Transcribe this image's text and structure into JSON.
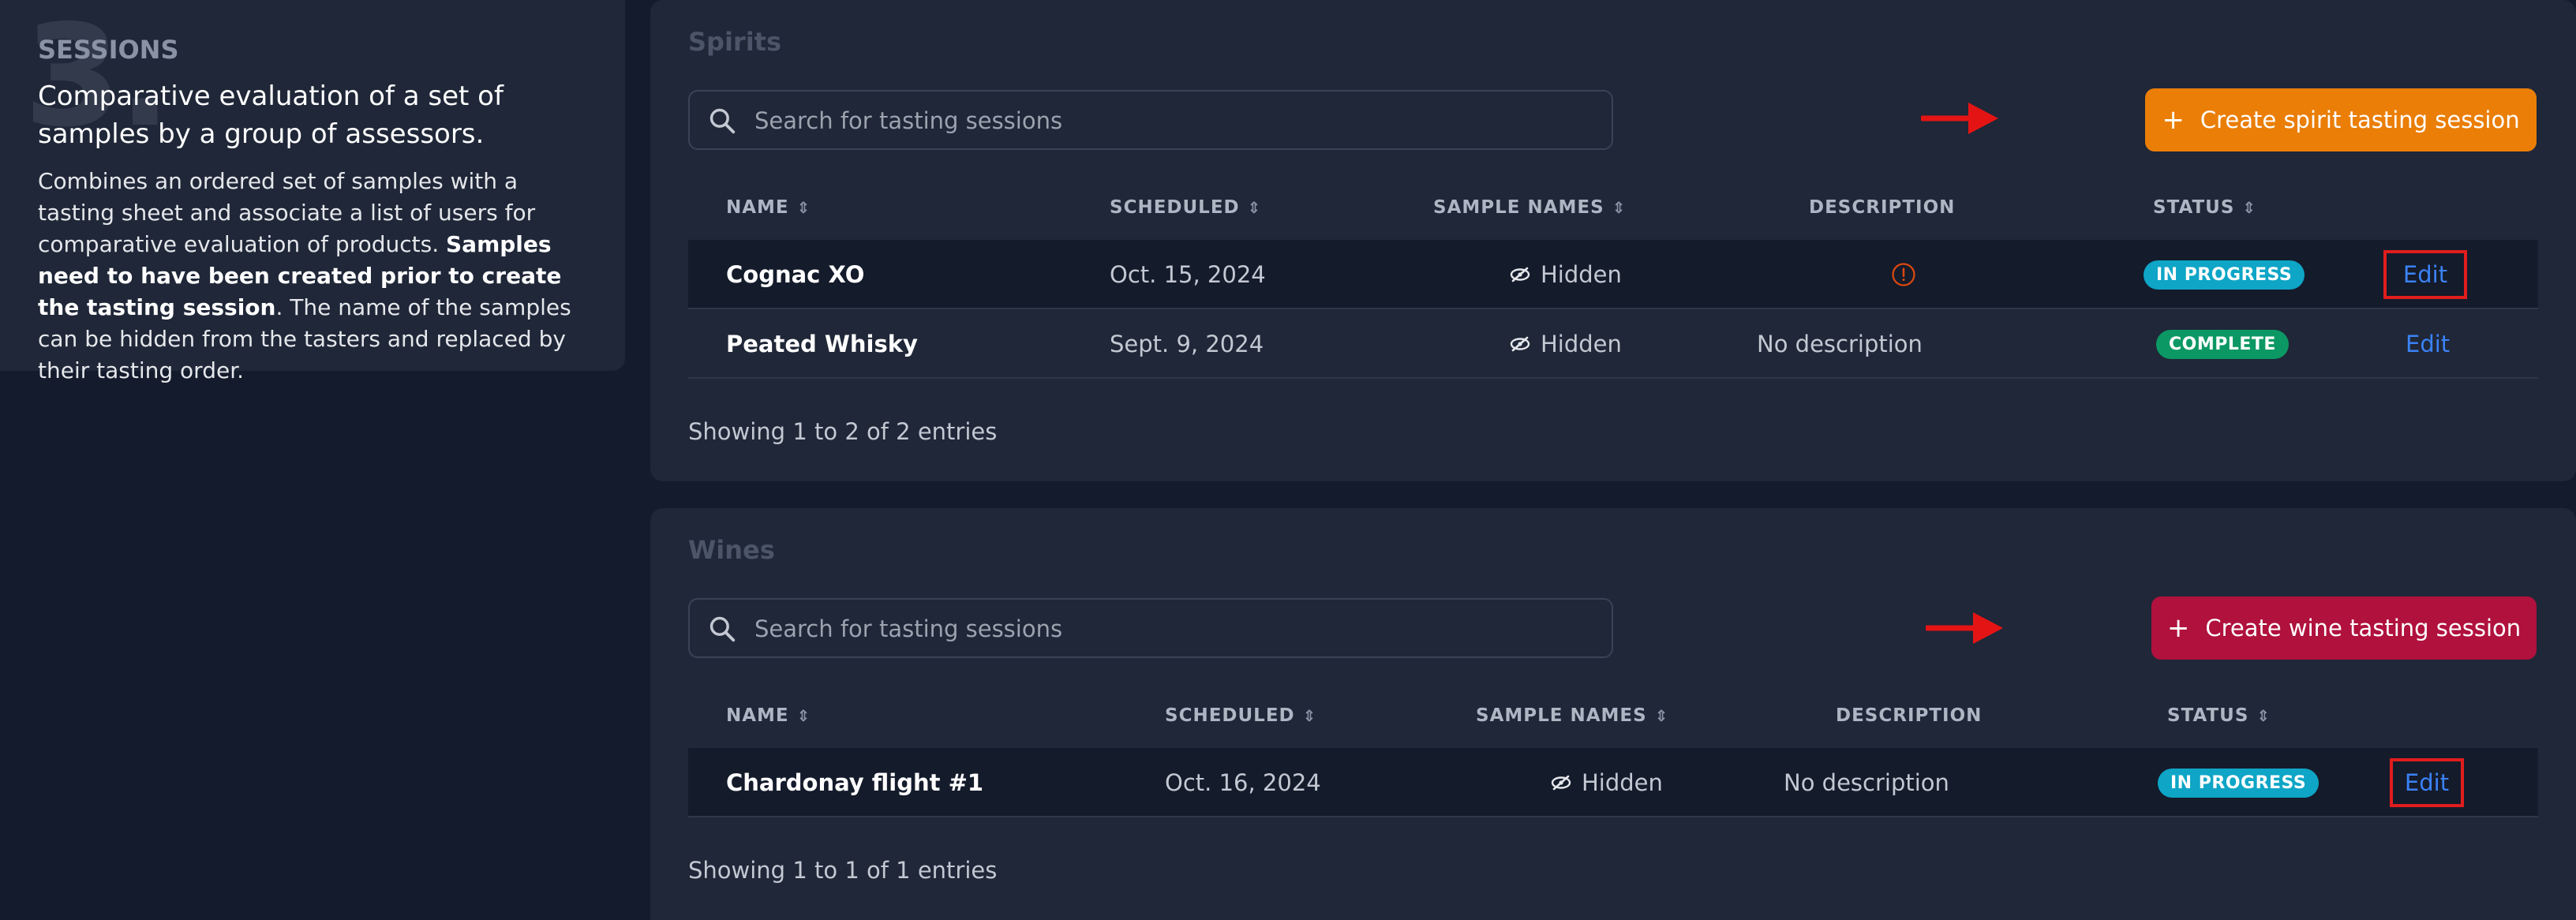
{
  "info": {
    "number": "3.",
    "title": "SESSIONS",
    "lead": "Comparative evaluation of a set of samples by a group of assessors.",
    "body_before": "Combines an ordered set of samples with a tasting sheet and associate a list of users for comparative evaluation of products. ",
    "body_bold": "Samples need to have been created prior to create the tasting session",
    "body_after": ". The name of the samples can be hidden from the tasters and replaced by their tasting order."
  },
  "spirits": {
    "title": "Spirits",
    "search_placeholder": "Search for tasting sessions",
    "create_label": "Create spirit tasting session",
    "columns": {
      "name": "NAME",
      "scheduled": "SCHEDULED",
      "sample_names": "SAMPLE NAMES",
      "description": "DESCRIPTION",
      "status": "STATUS"
    },
    "rows": [
      {
        "name": "Cognac XO",
        "scheduled": "Oct. 15, 2024",
        "sample_names": "Hidden",
        "description": "",
        "status": "IN PROGRESS",
        "action": "Edit"
      },
      {
        "name": "Peated Whisky",
        "scheduled": "Sept. 9, 2024",
        "sample_names": "Hidden",
        "description": "No description",
        "status": "COMPLETE",
        "action": "Edit"
      }
    ],
    "footer": "Showing 1 to 2 of 2 entries"
  },
  "wines": {
    "title": "Wines",
    "search_placeholder": "Search for tasting sessions",
    "create_label": "Create wine tasting session",
    "columns": {
      "name": "NAME",
      "scheduled": "SCHEDULED",
      "sample_names": "SAMPLE NAMES",
      "description": "DESCRIPTION",
      "status": "STATUS"
    },
    "rows": [
      {
        "name": "Chardonay flight #1",
        "scheduled": "Oct. 16, 2024",
        "sample_names": "Hidden",
        "description": "No description",
        "status": "IN PROGRESS",
        "action": "Edit"
      }
    ],
    "footer": "Showing 1 to 1 of 1 entries"
  },
  "colors": {
    "orange_button": "#ea7e07",
    "red_button": "#b0113d",
    "in_progress_badge": "#0ea5c6",
    "complete_badge": "#0c9864",
    "edit_link": "#3b82f6",
    "highlight": "#e11d1d"
  },
  "icons": {
    "search": "search-icon",
    "hidden": "eye-slash-icon",
    "info": "info-circle-icon",
    "sort": "sort-icon",
    "plus": "plus-icon",
    "arrow": "arrow-right-icon"
  }
}
